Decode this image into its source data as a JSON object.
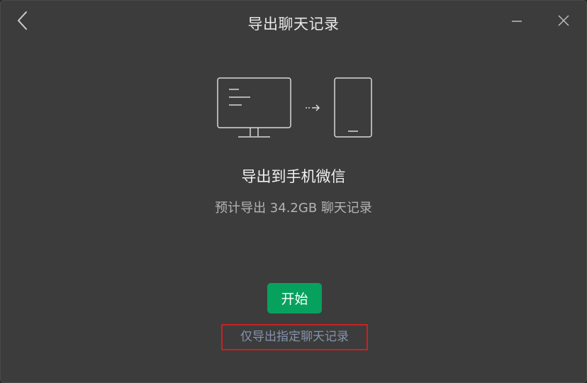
{
  "window": {
    "title": "导出聊天记录"
  },
  "titlebar": {
    "back_icon": "chevron-left-icon",
    "minimize_icon": "minimize-icon",
    "close_icon": "close-icon"
  },
  "illustration": {
    "icons": [
      "desktop-monitor-icon",
      "arrow-right-icon",
      "phone-icon"
    ]
  },
  "main": {
    "heading": "导出到手机微信",
    "subtext": "预计导出 34.2GB 聊天记录",
    "start_label": "开始",
    "partial_export_label": "仅导出指定聊天记录"
  },
  "colors": {
    "background": "#3c3c3c",
    "accent_green": "#07a15e",
    "link_color": "#8593ad",
    "highlight_border": "#d01f1f"
  }
}
